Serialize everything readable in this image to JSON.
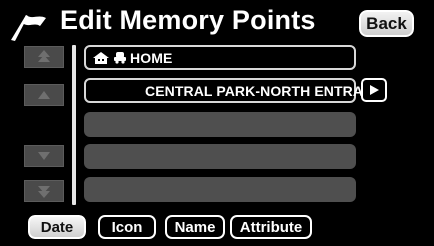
{
  "header": {
    "title": "Edit Memory Points",
    "back_label": "Back",
    "flag_icon": "flag-icon"
  },
  "list": {
    "rows": [
      {
        "label": "HOME",
        "icons": [
          "home-icon",
          "car-icon"
        ]
      },
      {
        "label": "CENTRAL PARK-NORTH ENTRA",
        "icons": [
          "poi-icon"
        ]
      },
      {
        "label": ""
      },
      {
        "label": ""
      },
      {
        "label": ""
      }
    ]
  },
  "scroll": {
    "icons": [
      "page-up-icon",
      "scroll-up-icon",
      "scroll-down-icon",
      "page-down-icon"
    ]
  },
  "sort": {
    "buttons": [
      {
        "label": "Date",
        "active": true
      },
      {
        "label": "Icon",
        "active": false
      },
      {
        "label": "Name",
        "active": false
      },
      {
        "label": "Attribute",
        "active": false
      }
    ]
  }
}
